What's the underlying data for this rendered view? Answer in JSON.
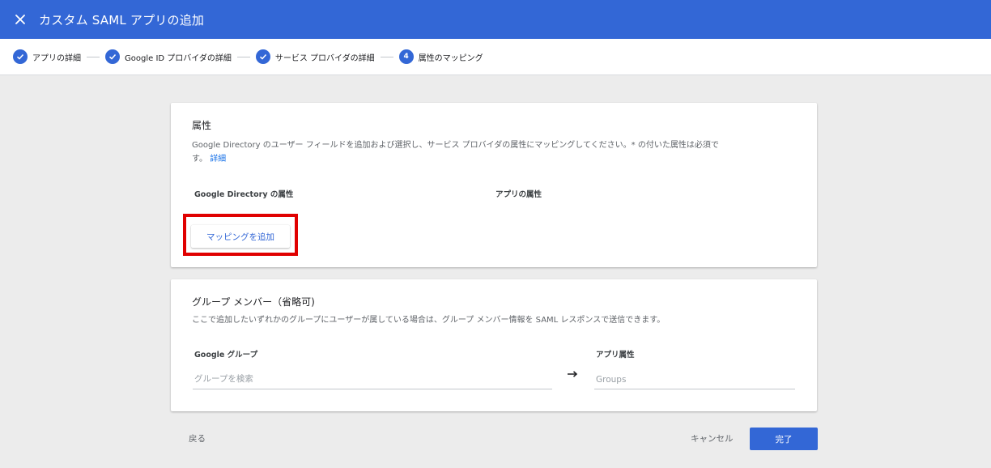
{
  "header": {
    "title": "カスタム SAML アプリの追加",
    "background_color": "#3367d6",
    "close_icon": "close-icon"
  },
  "stepper": {
    "steps": [
      {
        "label": "アプリの詳細",
        "state": "completed",
        "icon": "check-icon"
      },
      {
        "label": "Google ID プロバイダの詳細",
        "state": "completed",
        "icon": "check-icon"
      },
      {
        "label": "サービス プロバイダの詳細",
        "state": "completed",
        "icon": "check-icon"
      },
      {
        "label": "属性のマッピング",
        "state": "current",
        "number": "4"
      }
    ]
  },
  "attributes_card": {
    "title": "属性",
    "description_line1": "Google Directory のユーザー フィールドを追加および選択し、サービス プロバイダの属性にマッピングしてください。* の付いた属性は必須で",
    "description_line2": "す。",
    "details_link": "詳細",
    "col_directory": "Google Directory の属性",
    "col_app": "アプリの属性",
    "add_mapping_button": "マッピングを追加",
    "highlight_color": "#e00000"
  },
  "group_card": {
    "title": "グループ メンバー（省略可)",
    "description": "ここで追加したいずれかのグループにユーザーが属している場合は、グループ メンバー情報を SAML レスポンスで送信できます。",
    "col_google_group": "Google グループ",
    "col_app_attr": "アプリ属性",
    "search_placeholder": "グループを検索",
    "app_attr_placeholder": "Groups",
    "arrow_icon": "arrow-right-icon"
  },
  "footer": {
    "back": "戻る",
    "cancel": "キャンセル",
    "done": "完了",
    "accent_color": "#3367d6"
  }
}
